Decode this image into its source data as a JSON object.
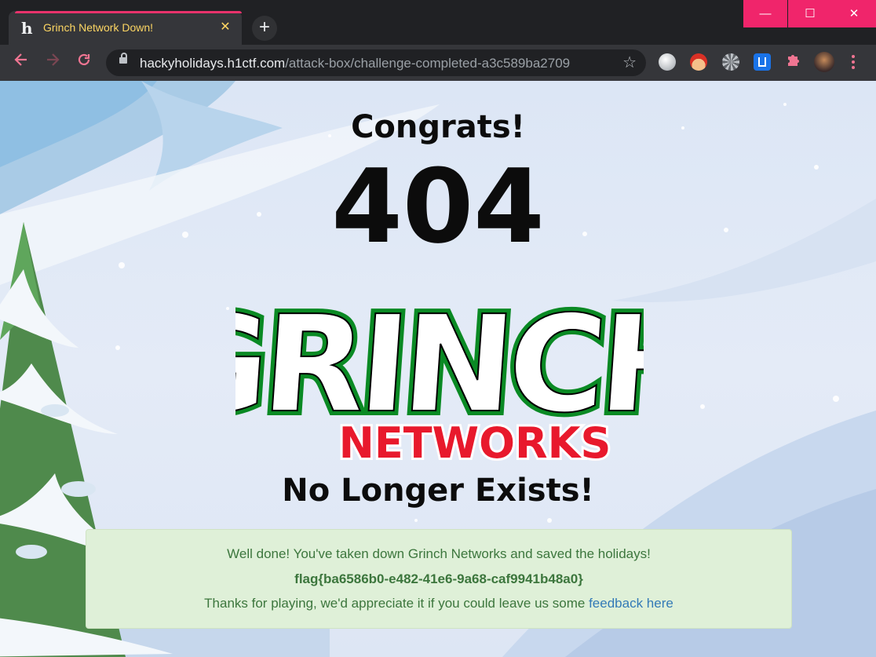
{
  "browser": {
    "tab_title": "Grinch Network Down!",
    "tab_favicon": "h",
    "tab_close": "✕",
    "new_tab": "+",
    "url_host": "hackyholidays.h1ctf.com",
    "url_path": "/attack-box/challenge-completed-a3c589ba2709",
    "window_controls": [
      "—",
      "☐",
      "✕"
    ],
    "nav_icons": [
      "back-arrow-icon",
      "forward-arrow-icon",
      "reload-icon"
    ],
    "extension_icons": [
      "globe-extension-icon",
      "santa-extension-icon",
      "gear-extension-icon",
      "shield-extension-icon",
      "puzzle-icon",
      "profile-avatar",
      "more-menu-icon"
    ],
    "accent_color": "#e8326c"
  },
  "page": {
    "congrats": "Congrats!",
    "code": "404",
    "logo_line1": "GRINCH",
    "logo_line2": "NETWORKS",
    "subtitle": "No Longer Exists!",
    "alert": {
      "message": "Well done! You've taken down Grinch Networks and saved the holidays!",
      "flag": "flag{ba6586b0-e482-41e6-9a68-caf9941b48a0}",
      "thanks": "Thanks for playing, we'd appreciate it if you could leave us some",
      "link": "feedback here"
    },
    "colors": {
      "logo_green": "#0a8a24",
      "logo_red": "#e8192c",
      "alert_bg": "#dff0d8",
      "alert_text": "#3c763d",
      "link": "#337ab7"
    }
  }
}
